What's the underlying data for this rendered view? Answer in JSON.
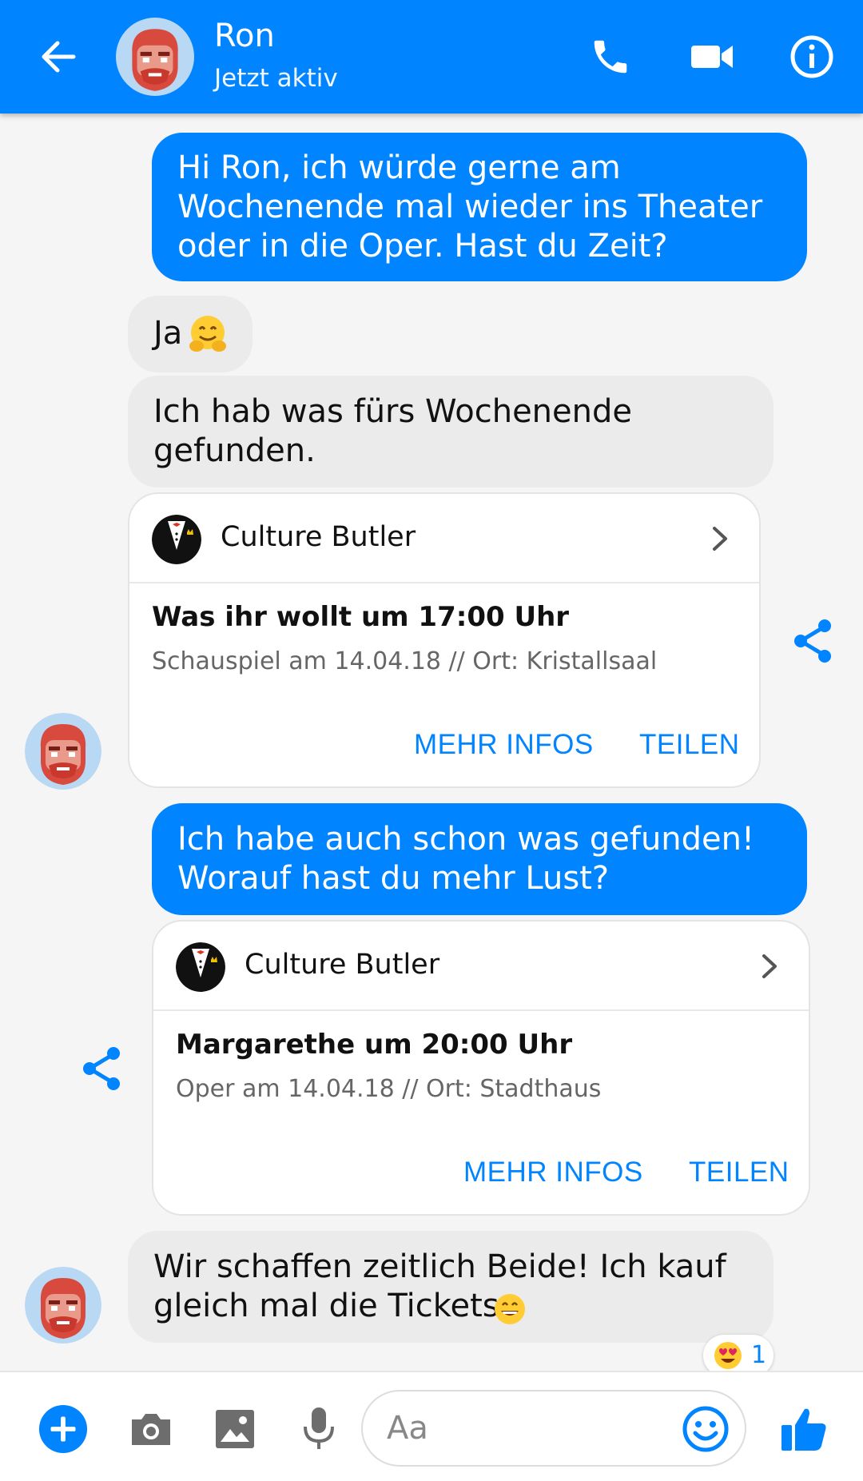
{
  "header": {
    "contact_name": "Ron",
    "status": "Jetzt aktiv",
    "accent": "#0084ff"
  },
  "messages": {
    "m1": {
      "lines": [
        "Hi Ron, ich würde gerne am",
        "Wochenende mal wieder ins Theater",
        "oder in die Oper. Hast du Zeit?"
      ]
    },
    "m2": {
      "text": "Ja"
    },
    "m3": {
      "lines": [
        "Ich hab was fürs Wochenende",
        "gefunden."
      ]
    },
    "card1": {
      "sender": "Culture Butler",
      "title": "Was ihr wollt um 17:00 Uhr",
      "subtitle": "Schauspiel am 14.04.18 // Ort: Kristallsaal",
      "more_label": "MEHR INFOS",
      "share_label": "TEILEN"
    },
    "m4": {
      "lines": [
        "Ich habe auch schon was gefunden!",
        "Worauf hast du mehr Lust?"
      ]
    },
    "card2": {
      "sender": "Culture Butler",
      "title": "Margarethe um 20:00 Uhr",
      "subtitle": "Oper am 14.04.18 // Ort: Stadthaus",
      "more_label": "MEHR INFOS",
      "share_label": "TEILEN"
    },
    "m5": {
      "lines": [
        "Wir schaffen zeitlich Beide! Ich kauf",
        "gleich mal die Tickets."
      ]
    }
  },
  "reaction": {
    "icon": "heart-eyes-emoji",
    "count": "1"
  },
  "composer": {
    "placeholder": "Aa"
  }
}
